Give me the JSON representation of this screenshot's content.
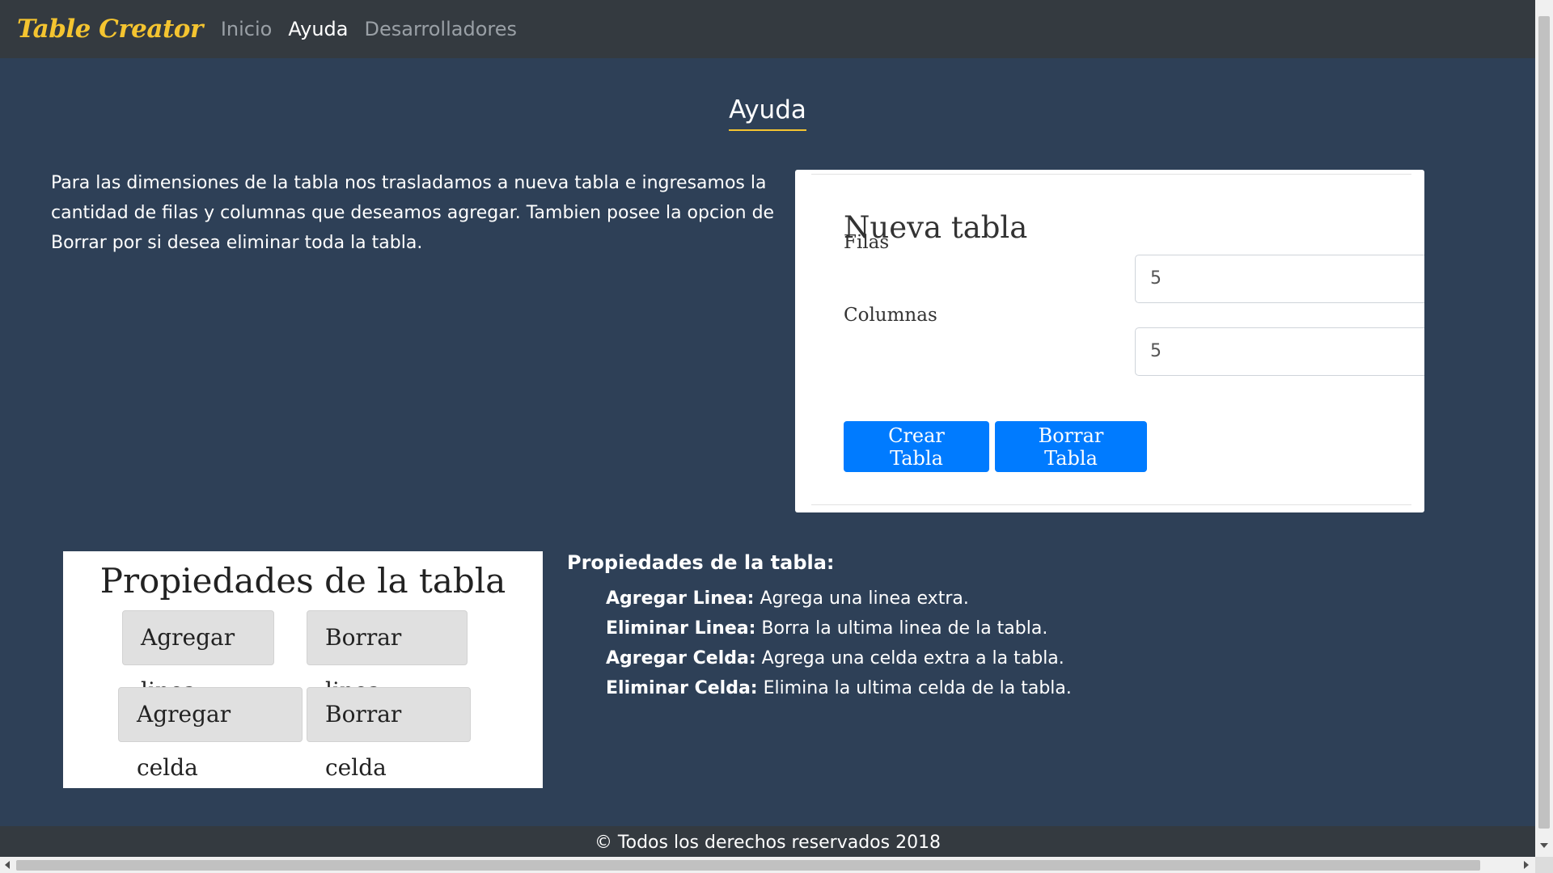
{
  "navbar": {
    "brand": "Table Creator",
    "links": [
      "Inicio",
      "Ayuda",
      "Desarrolladores"
    ],
    "active": "Ayuda"
  },
  "page": {
    "title": "Ayuda",
    "intro": "Para las dimensiones de la tabla nos trasladamos a nueva tabla e ingresamos la cantidad de filas y columnas que deseamos agregar. Tambien posee la opcion de Borrar por si desea eliminar toda la tabla."
  },
  "form_card": {
    "title": "Nueva tabla",
    "rows_label": "Filas",
    "rows_value": "5",
    "cols_label": "Columnas",
    "cols_value": "5",
    "create_button": "Crear Tabla",
    "delete_button": "Borrar Tabla"
  },
  "props_card": {
    "title": "Propiedades de la tabla",
    "buttons": [
      "Agregar linea",
      "Borrar linea",
      "Agregar celda",
      "Borrar celda"
    ]
  },
  "props_text": {
    "heading": "Propiedades de la tabla:",
    "items": [
      {
        "term": "Agregar Linea:",
        "desc": "Agrega una linea extra."
      },
      {
        "term": "Eliminar Linea:",
        "desc": "Borra la ultima linea de la tabla."
      },
      {
        "term": "Agregar Celda:",
        "desc": "Agrega una celda extra a la tabla."
      },
      {
        "term": "Eliminar Celda:",
        "desc": "Elimina la ultima celda de la tabla."
      }
    ]
  },
  "footer": {
    "text": "© Todos los derechos reservados 2018"
  },
  "colors": {
    "page_bg": "#2e4057",
    "navbar_bg": "#343a40",
    "brand": "#f4c430",
    "primary_button": "#007bff"
  }
}
